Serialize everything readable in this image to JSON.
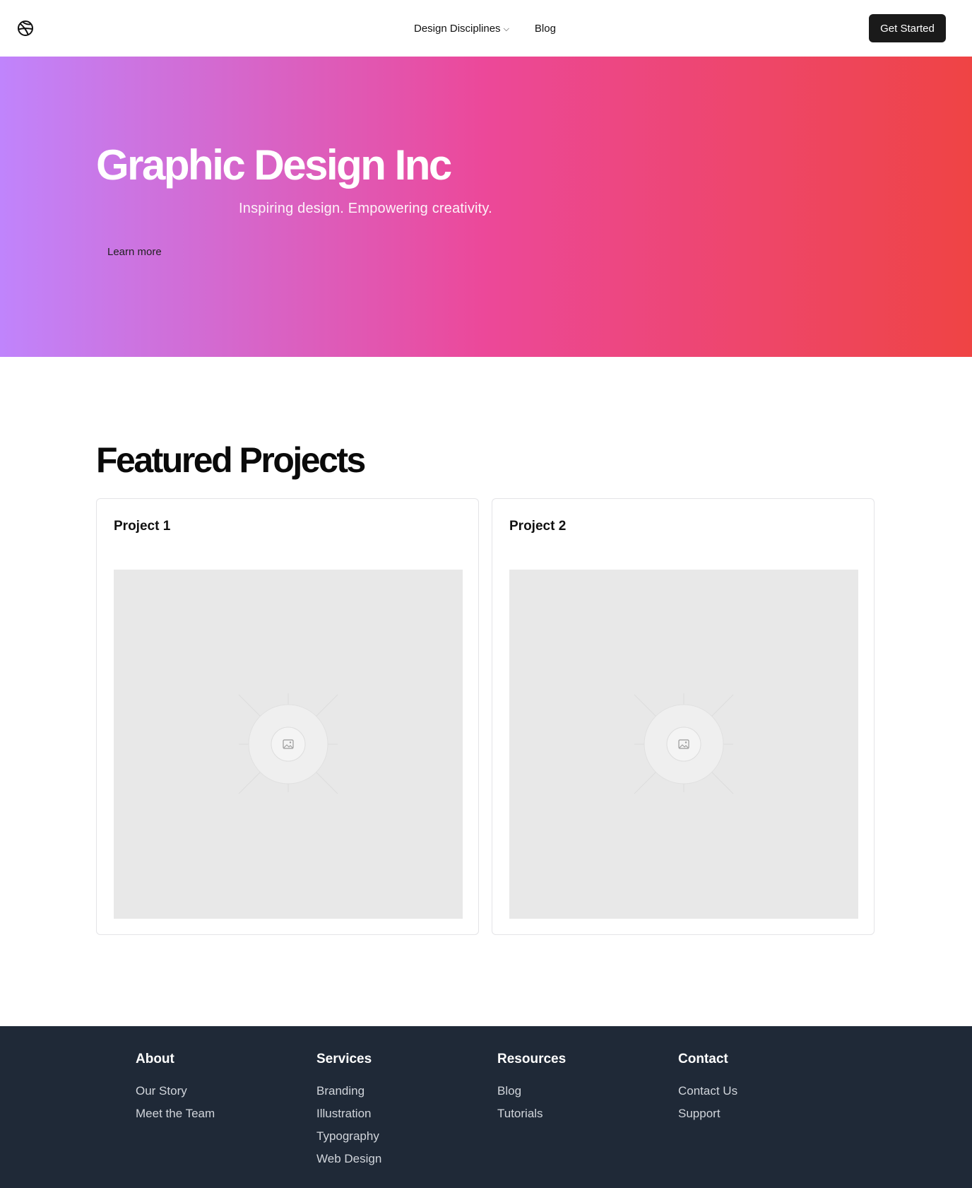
{
  "header": {
    "logo_icon": "dribbble-ball-icon",
    "nav": [
      {
        "label": "Design Disciplines",
        "icon": "chevron-down-icon",
        "has_dropdown": true
      },
      {
        "label": "Blog"
      }
    ],
    "cta_label": "Get Started"
  },
  "hero": {
    "title": "Graphic Design Inc",
    "subtitle": "Inspiring design. Empowering creativity.",
    "link_label": "Learn more",
    "gradient": [
      "#c084fc",
      "#ec4899",
      "#ef4444"
    ]
  },
  "featured": {
    "title": "Featured Projects",
    "projects": [
      {
        "title": "Project 1",
        "image_icon": "image-placeholder-icon"
      },
      {
        "title": "Project 2",
        "image_icon": "image-placeholder-icon"
      }
    ]
  },
  "footer": {
    "background": "#1f2937",
    "columns": [
      {
        "heading": "About",
        "links": [
          "Our Story",
          "Meet the Team"
        ]
      },
      {
        "heading": "Services",
        "links": [
          "Branding",
          "Illustration",
          "Typography",
          "Web Design"
        ]
      },
      {
        "heading": "Resources",
        "links": [
          "Blog",
          "Tutorials"
        ]
      },
      {
        "heading": "Contact",
        "links": [
          "Contact Us",
          "Support"
        ]
      }
    ]
  }
}
